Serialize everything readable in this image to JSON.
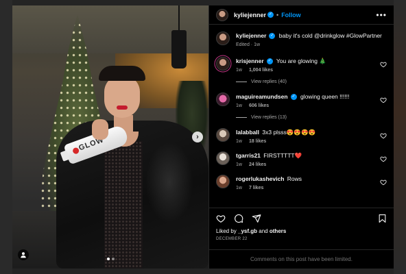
{
  "post": {
    "author": "kyliejenner",
    "follow_label": "Follow",
    "more_label": "•••",
    "caption_text": "baby it's cold @drinkglow #GlowPartner",
    "caption_meta": "Edited · 1w",
    "product_label": "GLOW",
    "liked_by_prefix": "Liked by",
    "liked_by_user": "_ysf.gb",
    "liked_by_and": "and",
    "liked_by_others": "others",
    "date": "DECEMBER 22",
    "comments_limited": "Comments on this post have been limited."
  },
  "carousel": {
    "next_label": "›",
    "total": 2,
    "current": 1
  },
  "comments": [
    {
      "user": "krisjenner",
      "verified": true,
      "text": "You are glowing 🎄",
      "time": "1w",
      "likes": "1,004 likes",
      "replies": "View replies (40)"
    },
    {
      "user": "maguireamundsen",
      "verified": true,
      "text": "glowing queen !!!!!!",
      "time": "1w",
      "likes": "606 likes",
      "replies": "View replies (13)"
    },
    {
      "user": "lalabball",
      "verified": false,
      "text": "3x3 plsss😍😍😍😍",
      "time": "1w",
      "likes": "18 likes",
      "replies": ""
    },
    {
      "user": "tgarris21",
      "verified": false,
      "text": "FIRSTTTTT❤️",
      "time": "1w",
      "likes": "24 likes",
      "replies": ""
    },
    {
      "user": "rogerlukashevich",
      "verified": false,
      "text": "Rows",
      "time": "1w",
      "likes": "7 likes",
      "replies": ""
    }
  ],
  "colors": {
    "accent": "#0095f6",
    "background": "#000000",
    "muted": "#a8a8a8"
  }
}
